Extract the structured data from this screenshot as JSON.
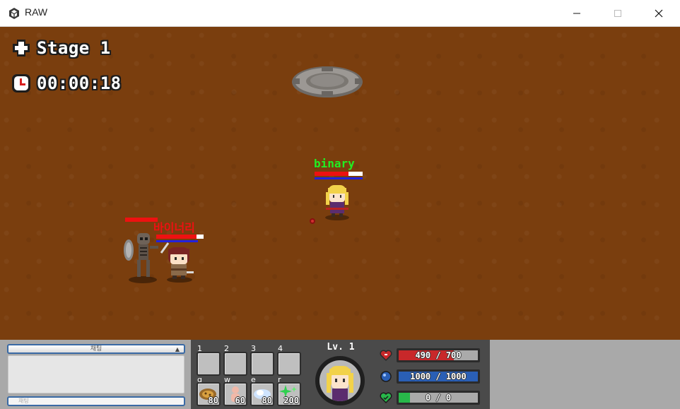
{
  "window": {
    "title": "RAW",
    "icon": "unity-cube-icon",
    "controls": [
      "minimize-icon",
      "maximize-icon",
      "close-icon"
    ]
  },
  "hud": {
    "stage_label": "Stage 1",
    "timer": "00:00:18"
  },
  "players": [
    {
      "name": "binary",
      "name_color": "#22ee22",
      "hp_fraction": 0.7,
      "mp_fraction": 1.0
    },
    {
      "name": "바이너리",
      "name_color": "#ee1111",
      "hp_fraction": 0.85,
      "mp_fraction": 0.88
    }
  ],
  "enemies": [
    {
      "type": "skeleton-shield",
      "hp_fraction": 1.0
    }
  ],
  "chat": {
    "header": "채팅",
    "input_placeholder": "채팅"
  },
  "hotbar": {
    "item_slots": [
      {
        "key": "1"
      },
      {
        "key": "2"
      },
      {
        "key": "3"
      },
      {
        "key": "4"
      }
    ],
    "skill_slots": [
      {
        "key": "q",
        "cost": "80",
        "icon": "meteor-skill-icon"
      },
      {
        "key": "w",
        "cost": "60",
        "icon": "summon-skill-icon"
      },
      {
        "key": "e",
        "cost": "80",
        "icon": "cloud-skill-icon"
      },
      {
        "key": "r",
        "cost": "200",
        "icon": "sparkle-skill-icon"
      }
    ]
  },
  "status": {
    "level": "Lv. 1",
    "hp": {
      "text": "490 / 700",
      "fraction": 0.7,
      "color": "#c8282a",
      "icon": "heart-icon"
    },
    "mp": {
      "text": "1000 / 1000",
      "fraction": 1.0,
      "color": "#2a5fb5",
      "icon": "mana-orb-icon"
    },
    "exp": {
      "text": "0 / 0",
      "fraction": 0.14,
      "color": "#28b84a",
      "icon": "exp-heart-icon"
    }
  }
}
